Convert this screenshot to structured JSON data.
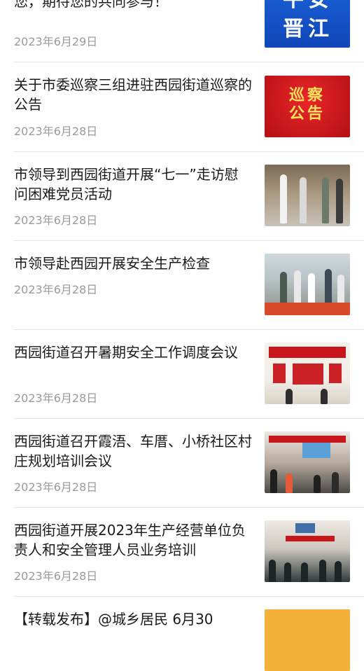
{
  "items": [
    {
      "title": "【平安建设】平安晋江 “治” 指\n您，期待您的共同参与！",
      "date": "2023年6月29日",
      "thumb_text": [
        "平安",
        "晋江"
      ]
    },
    {
      "title": "关于市委巡察三组进驻西园街道巡察的公告",
      "date": "2023年6月28日",
      "thumb_text": [
        "巡察",
        "公告"
      ]
    },
    {
      "title": "市领导到西园街道开展“七一”走访慰问困难党员活动",
      "date": "2023年6月28日"
    },
    {
      "title": "市领导赴西园开展安全生产检查",
      "date": "2023年6月28日"
    },
    {
      "title": "西园街道召开暑期安全工作调度会议",
      "date": "2023年6月28日"
    },
    {
      "title": "西园街道召开霞浯、车厝、小桥社区村庄规划培训会议",
      "date": "2023年6月28日"
    },
    {
      "title": "西园街道开展2023年生产经营单位负责人和安全管理人员业务培训",
      "date": "2023年6月28日"
    },
    {
      "title": "【转载发布】@城乡居民 6月30",
      "date": ""
    }
  ]
}
